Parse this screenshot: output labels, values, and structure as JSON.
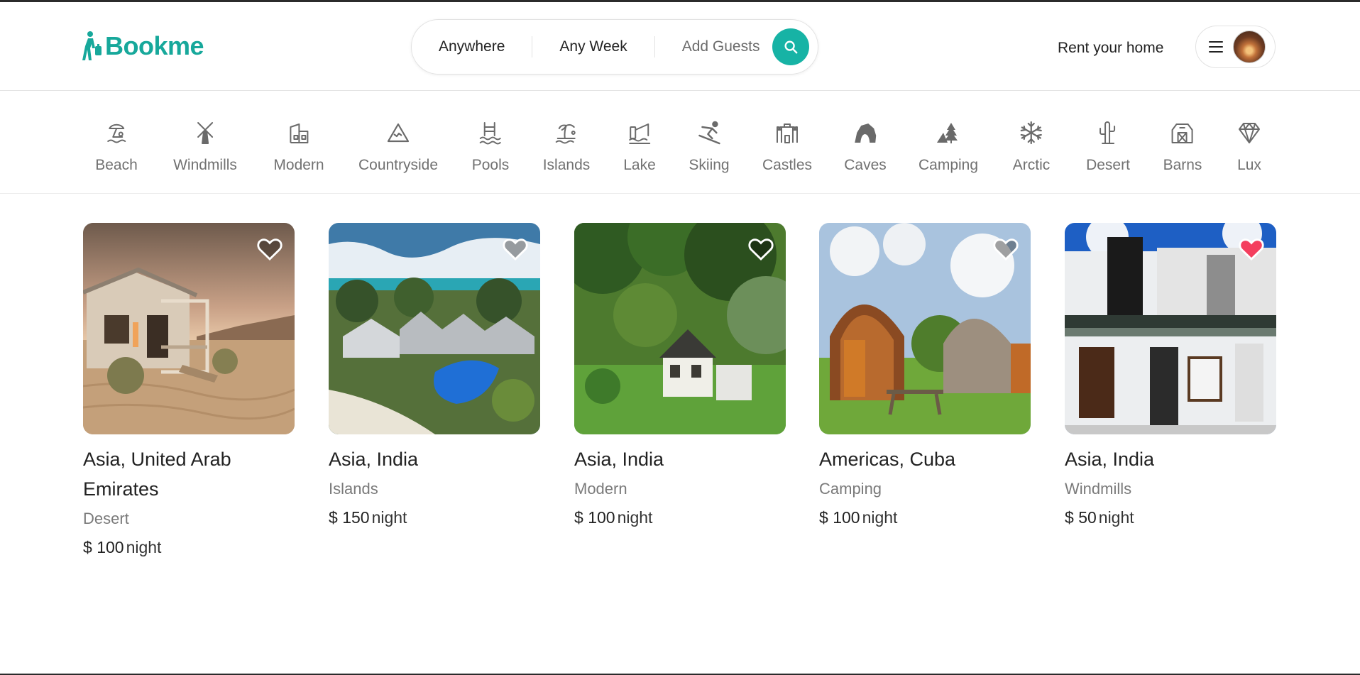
{
  "brand": {
    "name": "Bookme",
    "color": "#17a89b"
  },
  "search": {
    "where": "Anywhere",
    "when": "Any Week",
    "guests": "Add Guests"
  },
  "header": {
    "rent_label": "Rent your home"
  },
  "categories": [
    {
      "label": "Beach",
      "icon": "beach-icon"
    },
    {
      "label": "Windmills",
      "icon": "windmill-icon"
    },
    {
      "label": "Modern",
      "icon": "modern-building-icon"
    },
    {
      "label": "Countryside",
      "icon": "mountain-icon"
    },
    {
      "label": "Pools",
      "icon": "pool-icon"
    },
    {
      "label": "Islands",
      "icon": "island-icon"
    },
    {
      "label": "Lake",
      "icon": "lake-fishing-icon"
    },
    {
      "label": "Skiing",
      "icon": "skier-icon"
    },
    {
      "label": "Castles",
      "icon": "castle-icon"
    },
    {
      "label": "Caves",
      "icon": "cave-icon"
    },
    {
      "label": "Camping",
      "icon": "tent-tree-icon"
    },
    {
      "label": "Arctic",
      "icon": "snowflake-icon"
    },
    {
      "label": "Desert",
      "icon": "cactus-icon"
    },
    {
      "label": "Barns",
      "icon": "barn-icon"
    },
    {
      "label": "Lux",
      "icon": "diamond-icon"
    }
  ],
  "listings": [
    {
      "location": "Asia, United Arab Emirates",
      "category": "Desert",
      "currency": "$",
      "price": "100",
      "unit": "night",
      "favorited": false
    },
    {
      "location": "Asia, India",
      "category": "Islands",
      "currency": "$",
      "price": "150",
      "unit": "night",
      "favorited": false
    },
    {
      "location": "Asia, India",
      "category": "Modern",
      "currency": "$",
      "price": "100",
      "unit": "night",
      "favorited": false
    },
    {
      "location": "Americas, Cuba",
      "category": "Camping",
      "currency": "$",
      "price": "100",
      "unit": "night",
      "favorited": false
    },
    {
      "location": "Asia, India",
      "category": "Windmills",
      "currency": "$",
      "price": "50",
      "unit": "night",
      "favorited": true
    }
  ],
  "colors": {
    "accent": "#17b3a5",
    "favorite": "#f43f5e",
    "muted_text": "#717171"
  }
}
